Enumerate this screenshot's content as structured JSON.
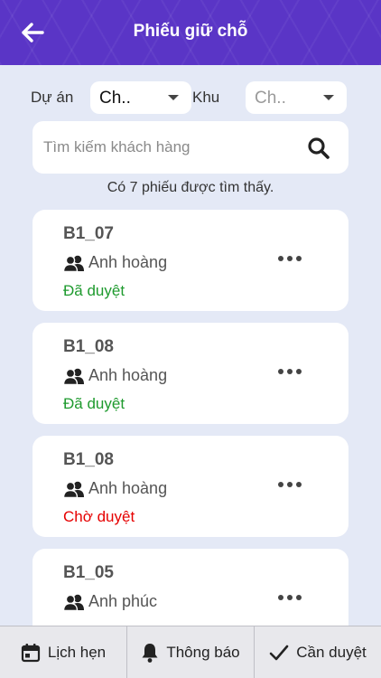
{
  "header": {
    "title": "Phiếu giữ chỗ",
    "back_icon": "arrow-left-icon"
  },
  "filters": {
    "project_label": "Dự án",
    "project_value": "Ch..",
    "area_label": "Khu",
    "area_value": "Ch.."
  },
  "search": {
    "placeholder": "Tìm kiếm khách hàng",
    "value": ""
  },
  "result_count": "Có 7 phiếu được tìm thấy.",
  "colors": {
    "accent": "#5a35c6",
    "approved": "#1e9a2e",
    "pending": "#e60000"
  },
  "cards": [
    {
      "code": "B1_07",
      "customer": "Anh hoàng",
      "status": "Đã duyệt"
    },
    {
      "code": "B1_08",
      "customer": "Anh hoàng",
      "status": "Đã duyệt"
    },
    {
      "code": "B1_08",
      "customer": "Anh hoàng",
      "status": "Chờ duyệt"
    },
    {
      "code": "B1_05",
      "customer": "Anh phúc",
      "status": ""
    }
  ],
  "bottom_tabs": [
    {
      "label": "Lịch hẹn",
      "icon": "calendar-icon"
    },
    {
      "label": "Thông báo",
      "icon": "bell-icon"
    },
    {
      "label": "Cần duyệt",
      "icon": "check-icon"
    }
  ]
}
